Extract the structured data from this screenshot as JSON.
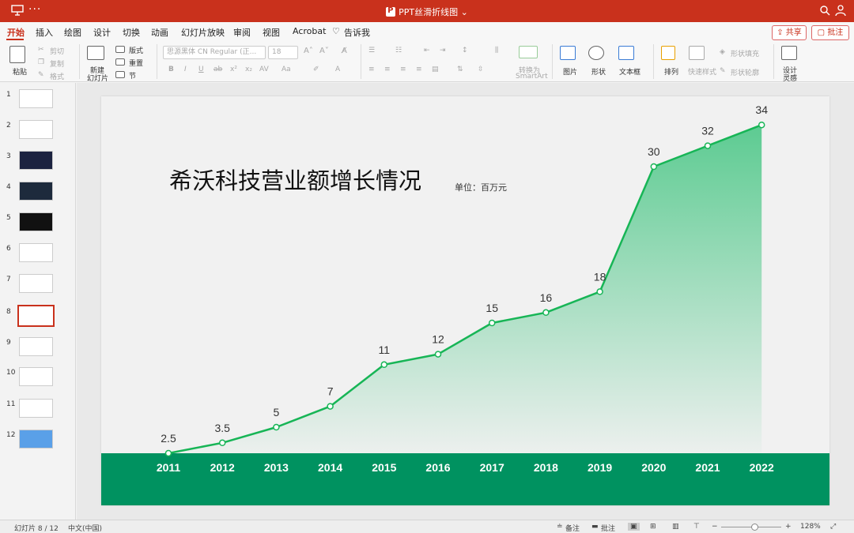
{
  "window": {
    "title": "PPT丝滑折线图",
    "more": "···"
  },
  "tabs": [
    "开始",
    "插入",
    "绘图",
    "设计",
    "切换",
    "动画",
    "幻灯片放映",
    "审阅",
    "视图",
    "Acrobat",
    "告诉我"
  ],
  "share_label": "共享",
  "comment_label": "批注",
  "ribbon": {
    "paste": "粘贴",
    "cut": "剪切",
    "copy": "复制",
    "format": "格式",
    "new_slide_1": "新建",
    "new_slide_2": "幻灯片",
    "layout": "版式",
    "reset": "重置",
    "section": "节",
    "font_name": "思源黑体 CN Regular (正...",
    "font_size": "18",
    "convert_1": "转换为",
    "convert_2": "SmartArt",
    "picture": "图片",
    "shape": "形状",
    "textbox": "文本框",
    "arrange": "排列",
    "quick_style": "快速样式",
    "shape_fill": "形状填充",
    "shape_outline": "形状轮廓",
    "designer_1": "设计",
    "designer_2": "灵感"
  },
  "thumbnails": [
    "1",
    "2",
    "3",
    "4",
    "5",
    "6",
    "7",
    "8",
    "9",
    "10",
    "11",
    "12"
  ],
  "selected_slide": 8,
  "slide": {
    "title": "希沃科技营业额增长情况",
    "unit": "单位：百万元"
  },
  "chart_data": {
    "type": "area",
    "categories": [
      "2011",
      "2012",
      "2013",
      "2014",
      "2015",
      "2016",
      "2017",
      "2018",
      "2019",
      "2020",
      "2021",
      "2022"
    ],
    "values": [
      2.5,
      3.5,
      5,
      7,
      11,
      12,
      15,
      16,
      18,
      30,
      32,
      34
    ],
    "value_labels": [
      "2.5",
      "3.5",
      "5",
      "7",
      "11",
      "12",
      "15",
      "16",
      "18",
      "30",
      "32",
      "34"
    ],
    "line_color": "#17b556",
    "fill_color": "#4cc787",
    "axis_band_color": "#009260",
    "grid": false
  },
  "status": {
    "slide_counter": "幻灯片 8 / 12",
    "language": "中文(中国)",
    "notes": "备注",
    "comments": "批注",
    "zoom": "128%"
  }
}
